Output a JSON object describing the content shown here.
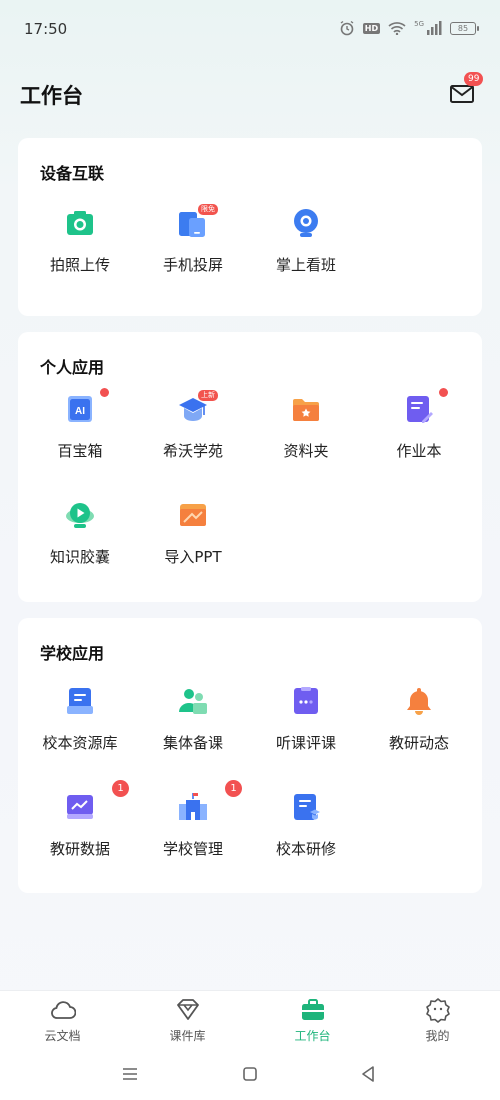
{
  "status_bar": {
    "time": "17:50",
    "battery": "85",
    "hd": "HD",
    "signal": "5G"
  },
  "header": {
    "title": "工作台",
    "mail_badge": "99"
  },
  "sections": [
    {
      "title": "设备互联",
      "apps": [
        {
          "label": "拍照上传",
          "icon": "camera-icon"
        },
        {
          "label": "手机投屏",
          "icon": "phone-cast-icon",
          "tag": "限免"
        },
        {
          "label": "掌上看班",
          "icon": "webcam-icon"
        }
      ]
    },
    {
      "title": "个人应用",
      "apps": [
        {
          "label": "百宝箱",
          "icon": "ai-box-icon",
          "dot": true
        },
        {
          "label": "希沃学苑",
          "icon": "graduation-cap-icon",
          "tag": "上新"
        },
        {
          "label": "资料夹",
          "icon": "folder-star-icon"
        },
        {
          "label": "作业本",
          "icon": "homework-book-icon",
          "dot": true
        },
        {
          "label": "知识胶囊",
          "icon": "capsule-play-icon"
        },
        {
          "label": "导入PPT",
          "icon": "ppt-folder-icon"
        }
      ]
    },
    {
      "title": "学校应用",
      "apps": [
        {
          "label": "校本资源库",
          "icon": "resource-library-icon"
        },
        {
          "label": "集体备课",
          "icon": "group-prep-icon"
        },
        {
          "label": "听课评课",
          "icon": "lesson-review-icon"
        },
        {
          "label": "教研动态",
          "icon": "bell-icon"
        },
        {
          "label": "教研数据",
          "icon": "data-chart-icon",
          "count": "1"
        },
        {
          "label": "学校管理",
          "icon": "school-building-icon",
          "count": "1"
        },
        {
          "label": "校本研修",
          "icon": "training-doc-icon"
        }
      ]
    }
  ],
  "tabs": [
    {
      "label": "云文档",
      "icon": "cloud-icon"
    },
    {
      "label": "课件库",
      "icon": "courseware-icon"
    },
    {
      "label": "工作台",
      "icon": "briefcase-icon",
      "active": true
    },
    {
      "label": "我的",
      "icon": "profile-badge-icon"
    }
  ],
  "colors": {
    "accent": "#1eb47b",
    "badge": "#f25151"
  }
}
